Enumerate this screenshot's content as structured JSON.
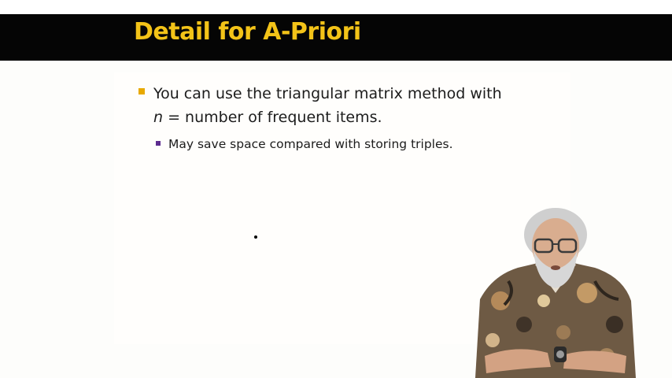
{
  "slide": {
    "title": "Detail for A-Priori",
    "bullets": [
      {
        "lead": "You can use the triangular matrix method with ",
        "var": "n",
        "rest": " = number of frequent items."
      }
    ],
    "sub_bullets": [
      {
        "text": "May save space compared with storing triples."
      }
    ]
  },
  "presenter": {
    "icon": "presenter-video-overlay"
  },
  "colors": {
    "title_bar": "#050505",
    "title_text": "#f3c318",
    "bullet_marker": "#e8a900",
    "sub_bullet_marker": "#5d2c8f"
  }
}
